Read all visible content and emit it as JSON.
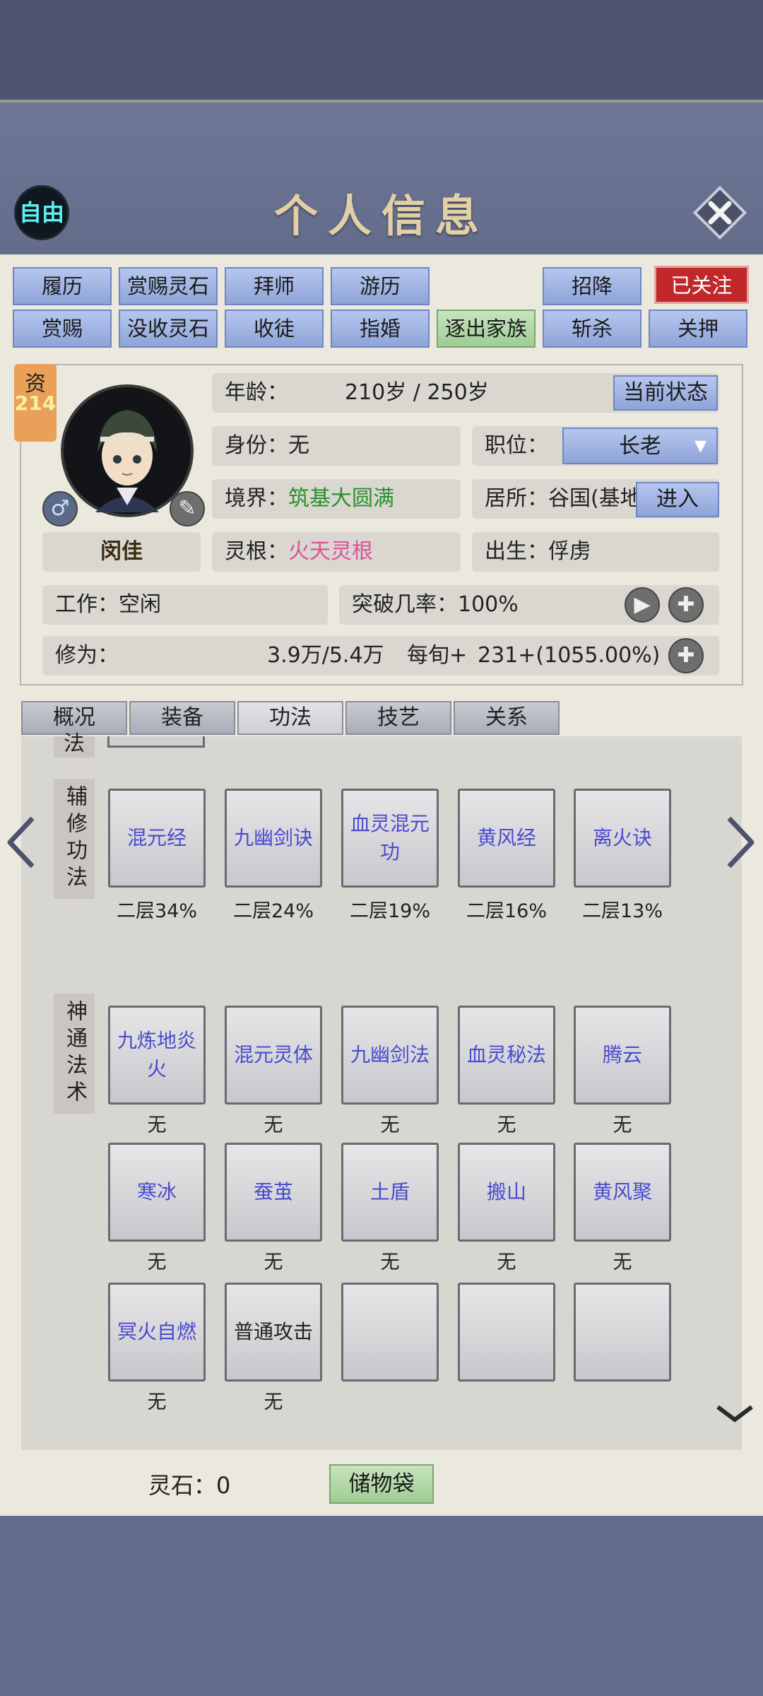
{
  "title": "个人信息",
  "mode_badge": "自由",
  "buttons_row1": [
    {
      "label": "履历",
      "style": "blue"
    },
    {
      "label": "赏赐灵石",
      "style": "blue"
    },
    {
      "label": "拜师",
      "style": "blue"
    },
    {
      "label": "游历",
      "style": "blue"
    },
    {
      "label": "招降",
      "style": "blue"
    },
    {
      "label": "已关注",
      "style": "red"
    }
  ],
  "buttons_row2": [
    {
      "label": "赏赐",
      "style": "blue"
    },
    {
      "label": "没收灵石",
      "style": "blue"
    },
    {
      "label": "收徒",
      "style": "blue"
    },
    {
      "label": "指婚",
      "style": "blue"
    },
    {
      "label": "逐出家族",
      "style": "green"
    },
    {
      "label": "斩杀",
      "style": "blue"
    },
    {
      "label": "关押",
      "style": "blue"
    }
  ],
  "profile": {
    "aptitude_label": "资",
    "aptitude_value": "214",
    "name": "闵佳",
    "age_label": "年龄：",
    "age_value": "210岁 / 250岁",
    "status_button": "当前状态",
    "identity_label": "身份：",
    "identity_value": "无",
    "position_label": "职位：",
    "position_value": "长老",
    "realm_label": "境界：",
    "realm_value": "筑基大圆满",
    "residence_label": "居所：",
    "residence_value": "谷国(基地",
    "enter_button": "进入",
    "root_label": "灵根：",
    "root_value": "火天灵根",
    "birth_label": "出生：",
    "birth_value": "俘虏",
    "work_label": "工作：",
    "work_value": "空闲",
    "breakthrough_label": "突破几率：",
    "breakthrough_value": "100%",
    "cultivation_label": "修为：",
    "cultivation_value": "3.9万/5.4万",
    "per_period_label": "每旬+",
    "per_period_value": "231+(1055.00%)"
  },
  "tabs": [
    {
      "label": "概况",
      "active": false
    },
    {
      "label": "装备",
      "active": false
    },
    {
      "label": "功法",
      "active": true
    },
    {
      "label": "技艺",
      "active": false
    },
    {
      "label": "关系",
      "active": false
    }
  ],
  "sections": {
    "top_partial_label": "法",
    "aux_label": "辅修功法",
    "aux_skills": [
      {
        "name": "混元经",
        "level": "二层34%"
      },
      {
        "name": "九幽剑诀",
        "level": "二层24%"
      },
      {
        "name": "血灵混元功",
        "level": "二层19%"
      },
      {
        "name": "黄风经",
        "level": "二层16%"
      },
      {
        "name": "离火诀",
        "level": "二层13%"
      }
    ],
    "spell_label": "神通法术",
    "spells_row1": [
      {
        "name": "九炼地炎火",
        "level": "无"
      },
      {
        "name": "混元灵体",
        "level": "无"
      },
      {
        "name": "九幽剑法",
        "level": "无"
      },
      {
        "name": "血灵秘法",
        "level": "无"
      },
      {
        "name": "腾云",
        "level": "无"
      }
    ],
    "spells_row2": [
      {
        "name": "寒冰",
        "level": "无"
      },
      {
        "name": "蚕茧",
        "level": "无"
      },
      {
        "name": "土盾",
        "level": "无"
      },
      {
        "name": "搬山",
        "level": "无"
      },
      {
        "name": "黄风聚",
        "level": "无"
      }
    ],
    "spells_row3": [
      {
        "name": "冥火自燃",
        "level": "无"
      },
      {
        "name": "普通攻击",
        "level": "无"
      },
      {
        "name": "",
        "level": ""
      },
      {
        "name": "",
        "level": ""
      },
      {
        "name": "",
        "level": ""
      }
    ]
  },
  "footer": {
    "spirit_stone_label": "灵石：",
    "spirit_stone_value": "0",
    "bag_button": "储物袋"
  },
  "colors": {
    "accent_blue": "#8ea4d8",
    "followed_red": "#c0282a",
    "realm_green": "#2a8f2a",
    "root_pink": "#e0509a",
    "skill_text": "#4a4ad0"
  }
}
